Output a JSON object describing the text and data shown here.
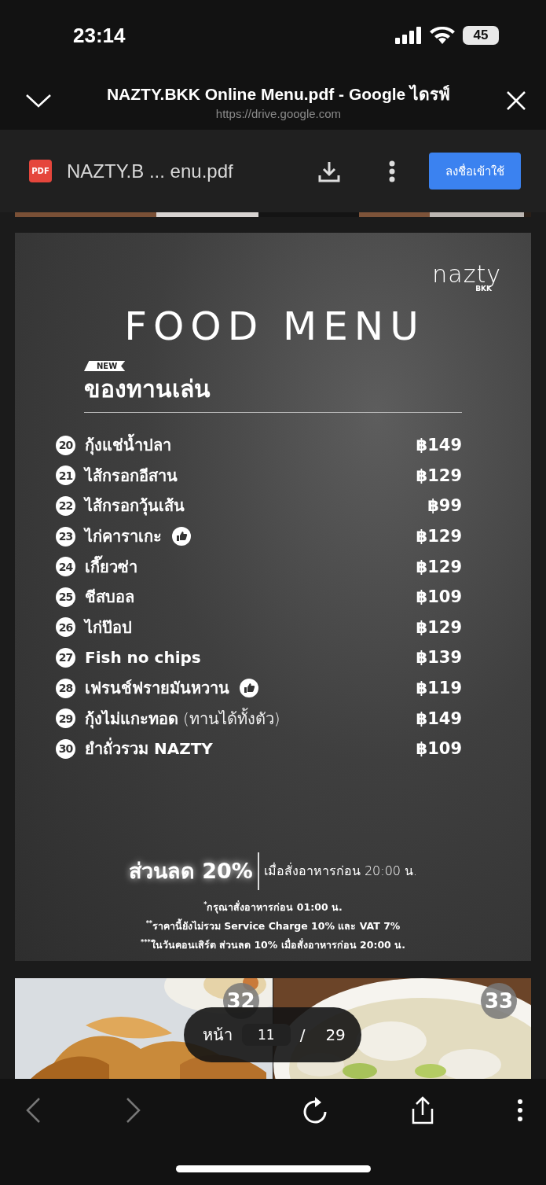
{
  "status_bar": {
    "time": "23:14",
    "battery": "45"
  },
  "header": {
    "title": "NAZTY.BKK Online Menu.pdf - Google ไดรฟ์",
    "url": "https://drive.google.com"
  },
  "toolbar": {
    "file_badge": "PDF",
    "file_name": "NAZTY.B ... enu.pdf",
    "sign_in": "ลงชื่อเข้าใช้"
  },
  "page": {
    "logo": "nazty",
    "logo_sub": "BKK",
    "title": "FOOD MENU",
    "ribbon": "NEW",
    "section": "ของทานเล่น",
    "items": [
      {
        "number": "20",
        "name": "กุ้งแช่น้ำปลา",
        "price": "฿149",
        "recommended": false
      },
      {
        "number": "21",
        "name": "ไส้กรอกอีสาน",
        "price": "฿129",
        "recommended": false
      },
      {
        "number": "22",
        "name": "ไส้กรอกวุ้นเส้น",
        "price": "฿99",
        "recommended": false
      },
      {
        "number": "23",
        "name": "ไก่คาราเกะ",
        "price": "฿129",
        "recommended": true
      },
      {
        "number": "24",
        "name": "เกี๊ยวซ่า",
        "price": "฿129",
        "recommended": false
      },
      {
        "number": "25",
        "name": "ชีสบอล",
        "price": "฿109",
        "recommended": false
      },
      {
        "number": "26",
        "name": "ไก่ป๊อป",
        "price": "฿129",
        "recommended": false
      },
      {
        "number": "27",
        "name": "Fish no chips",
        "price": "฿139",
        "recommended": false
      },
      {
        "number": "28",
        "name": "เฟรนช์ฟรายมันหวาน",
        "price": "฿119",
        "recommended": true
      },
      {
        "number": "29",
        "name": "กุ้งไม่แกะทอด",
        "note": "(ทานได้ทั้งตัว)",
        "price": "฿149",
        "recommended": false
      },
      {
        "number": "30",
        "name": "ยำถั่วรวม NAZTY",
        "price": "฿109",
        "recommended": false
      }
    ],
    "discount": "ส่วนลด 20%",
    "discount_condition": "เมื่อสั่งอาหารก่อน 20:00 น.",
    "notes": [
      "$^{*}$กรุณาสั่งอาหารก่อน 01:00 น.",
      "$^{**}$ราคานี้ยังไม่รวม Service Charge 10% และ VAT 7%",
      "$^{***}$ในวันคอนเสิร์ต ส่วนลด 10% เมื่อสั่งอาหารก่อน 20:00 น."
    ]
  },
  "next_page": {
    "badges": [
      "32",
      "33"
    ]
  },
  "page_indicator": {
    "label": "หน้า",
    "current": "11",
    "separator": "/",
    "total": "29"
  },
  "bottom_bar": {
    "back_disabled": true,
    "forward_disabled": true
  }
}
